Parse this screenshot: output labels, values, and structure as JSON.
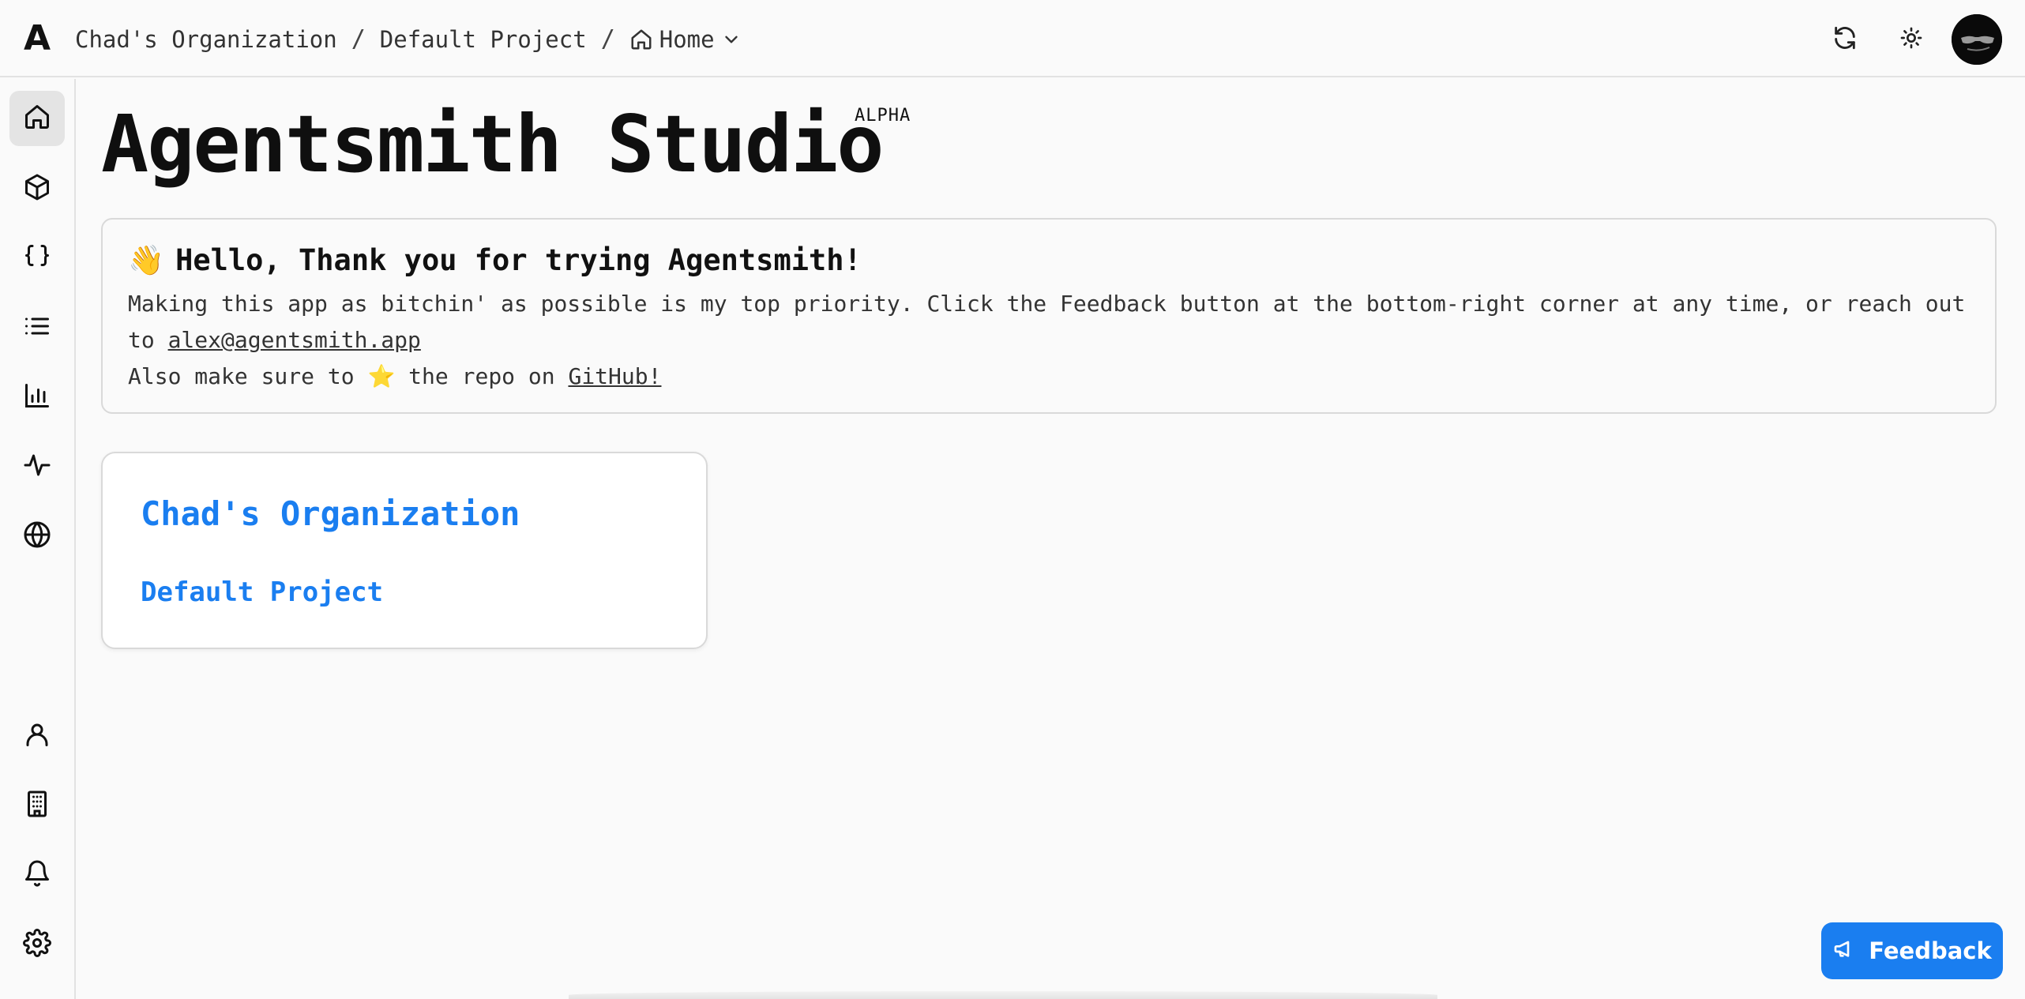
{
  "app": {
    "logo": "A",
    "title": "Agentsmith Studio",
    "badge": "ALPHA"
  },
  "breadcrumb": {
    "organization": "Chad's Organization",
    "separator1": "/",
    "project": "Default Project",
    "separator2": "/",
    "page": "Home"
  },
  "topbar_icons": [
    "refresh-icon",
    "theme-toggle-icon",
    "avatar"
  ],
  "sidebar": {
    "top_items": [
      "home-icon",
      "box-icon",
      "braces-icon",
      "list-icon",
      "bar-chart-icon",
      "activity-icon",
      "globe-icon"
    ],
    "bottom_items": [
      "user-icon",
      "building-icon",
      "bell-icon",
      "settings-icon"
    ],
    "active": "home-icon"
  },
  "welcome": {
    "emoji": "👋",
    "heading": "Hello, Thank you for trying Agentsmith!",
    "line1": "Making this app as bitchin' as possible is my top priority. Click the Feedback button at the bottom-right corner at any time, or reach out to ",
    "email": "alex@agentsmith.app",
    "line2_prefix": "Also make sure to ",
    "star": "⭐",
    "line2_mid": " the repo on ",
    "github_link": "GitHub!"
  },
  "organizations": [
    {
      "name": "Chad's Organization",
      "projects": [
        "Default Project"
      ]
    }
  ],
  "feedback_button": {
    "label": "Feedback"
  },
  "colors": {
    "accent": "#1a7ef0",
    "background": "#fafafa",
    "border": "#d9d9d9",
    "active_nav": "#e4e4e4"
  }
}
